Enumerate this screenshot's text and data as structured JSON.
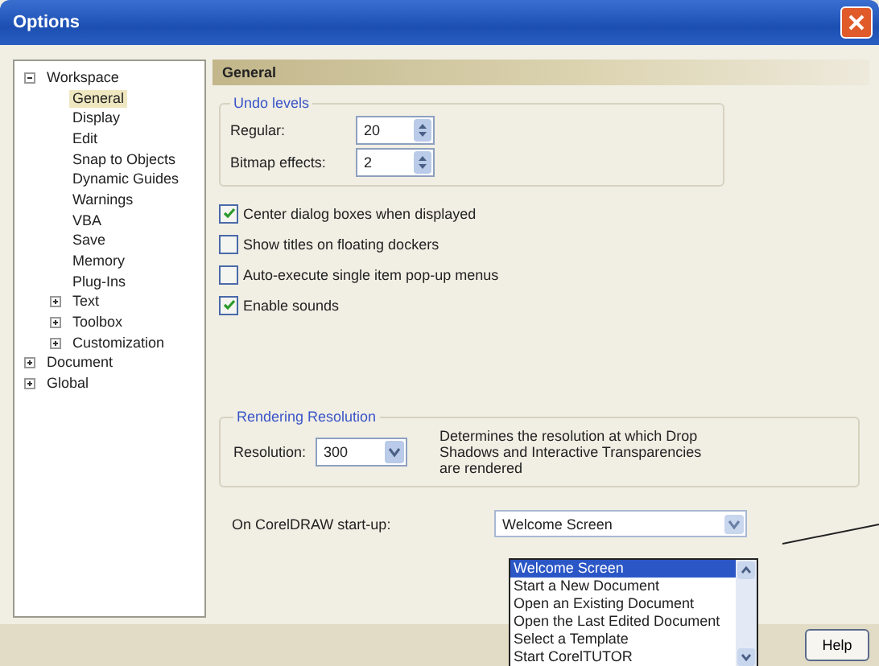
{
  "window": {
    "title": "Options"
  },
  "tree": [
    {
      "label": "Workspace",
      "expanded": true,
      "selected": false,
      "children": [
        {
          "label": "General",
          "selected": true
        },
        {
          "label": "Display",
          "selected": false
        },
        {
          "label": "Edit",
          "selected": false
        },
        {
          "label": "Snap to Objects",
          "selected": false
        },
        {
          "label": "Dynamic Guides",
          "selected": false
        },
        {
          "label": "Warnings",
          "selected": false
        },
        {
          "label": "VBA",
          "selected": false
        },
        {
          "label": "Save",
          "selected": false
        },
        {
          "label": "Memory",
          "selected": false
        },
        {
          "label": "Plug-Ins",
          "selected": false
        },
        {
          "label": "Text",
          "expanded": false,
          "selected": false
        },
        {
          "label": "Toolbox",
          "expanded": false,
          "selected": false
        },
        {
          "label": "Customization",
          "expanded": false,
          "selected": false
        }
      ]
    },
    {
      "label": "Document",
      "expanded": false,
      "selected": false
    },
    {
      "label": "Global",
      "expanded": false,
      "selected": false
    }
  ],
  "panel": {
    "title": "General",
    "undo": {
      "title": "Undo levels",
      "fields": [
        {
          "label": "Regular:",
          "value": "20"
        },
        {
          "label": "Bitmap effects:",
          "value": "2"
        }
      ]
    },
    "options": [
      {
        "label": "Center dialog boxes when displayed",
        "checked": true
      },
      {
        "label": "Show titles on floating dockers",
        "checked": false
      },
      {
        "label": "Auto-execute single item pop-up menus",
        "checked": false
      },
      {
        "label": "Enable sounds",
        "checked": true
      }
    ],
    "rendering": {
      "title": "Rendering Resolution",
      "label": "Resolution:",
      "value": "300",
      "description": "Determines the resolution at which Drop Shadows and Interactive Transparencies are rendered"
    },
    "startup": {
      "label": "On CorelDRAW start-up:",
      "value": "Welcome Screen",
      "options": [
        {
          "label": "Welcome Screen",
          "selected": true
        },
        {
          "label": "Start a New Document",
          "selected": false
        },
        {
          "label": "Open an Existing Document",
          "selected": false
        },
        {
          "label": "Open the Last Edited Document",
          "selected": false
        },
        {
          "label": "Select a Template",
          "selected": false
        },
        {
          "label": "Start CorelTUTOR",
          "selected": false
        }
      ]
    }
  },
  "buttons": [
    "Help"
  ]
}
